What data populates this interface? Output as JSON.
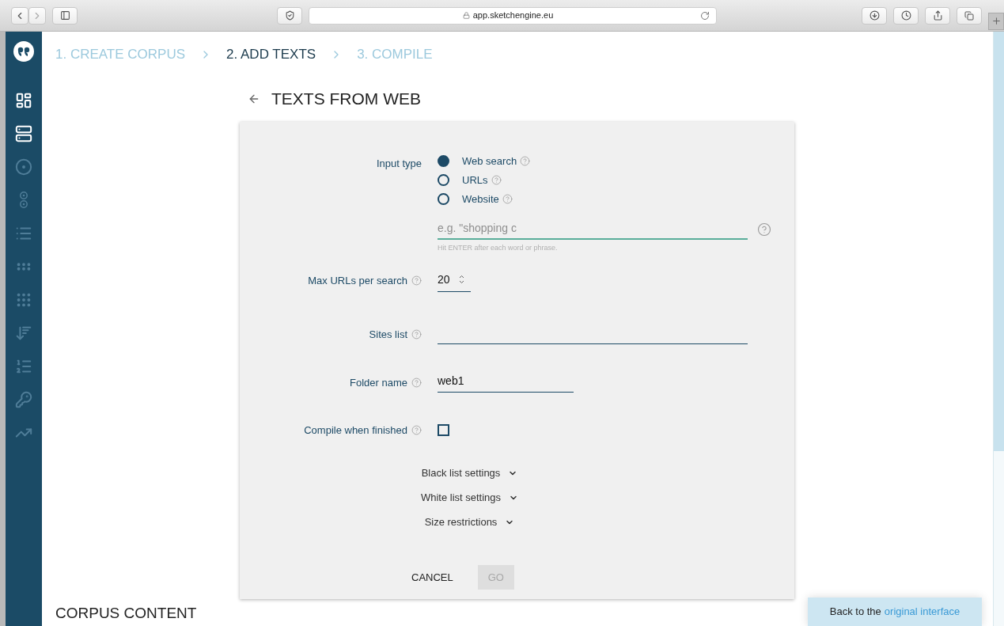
{
  "browser": {
    "url": "app.sketchengine.eu"
  },
  "sidebar": {
    "items": [
      {
        "kind": "dashboard",
        "active": true
      },
      {
        "kind": "list",
        "active": true
      },
      {
        "kind": "target",
        "active": false
      },
      {
        "kind": "pair",
        "active": false
      },
      {
        "kind": "bullets",
        "active": false
      },
      {
        "kind": "grip",
        "active": false
      },
      {
        "kind": "grip2",
        "active": false
      },
      {
        "kind": "sort",
        "active": false
      },
      {
        "kind": "ordered",
        "active": false
      },
      {
        "kind": "key",
        "active": false
      },
      {
        "kind": "trend",
        "active": false
      }
    ]
  },
  "steps": [
    {
      "label": "1. CREATE CORPUS",
      "selected": false
    },
    {
      "label": "2. ADD TEXTS",
      "selected": true
    },
    {
      "label": "3. COMPILE",
      "selected": false
    }
  ],
  "page_title": "TEXTS FROM WEB",
  "form": {
    "input_type": {
      "label": "Input type",
      "options": [
        {
          "label": "Web search",
          "selected": true
        },
        {
          "label": "URLs",
          "selected": false
        },
        {
          "label": "Website",
          "selected": false
        }
      ]
    },
    "search": {
      "placeholder": "e.g. \"shopping c",
      "hint": "Hit ENTER after each word or phrase."
    },
    "max_urls": {
      "label": "Max URLs per search",
      "value": "20"
    },
    "sites_list": {
      "label": "Sites list"
    },
    "folder_name": {
      "label": "Folder name",
      "value": "web1"
    },
    "compile": {
      "label": "Compile when finished",
      "checked": false
    },
    "expanders": [
      {
        "label": "Black list settings",
        "expanded": false
      },
      {
        "label": "White list settings",
        "expanded": false
      },
      {
        "label": "Size restrictions",
        "expanded": false
      }
    ],
    "buttons": [
      {
        "label": "CANCEL",
        "disabled": false
      },
      {
        "label": "GO",
        "disabled": true
      }
    ]
  },
  "section_heading": "CORPUS CONTENT",
  "notice": {
    "text": "Back to the",
    "link": "original interface"
  }
}
